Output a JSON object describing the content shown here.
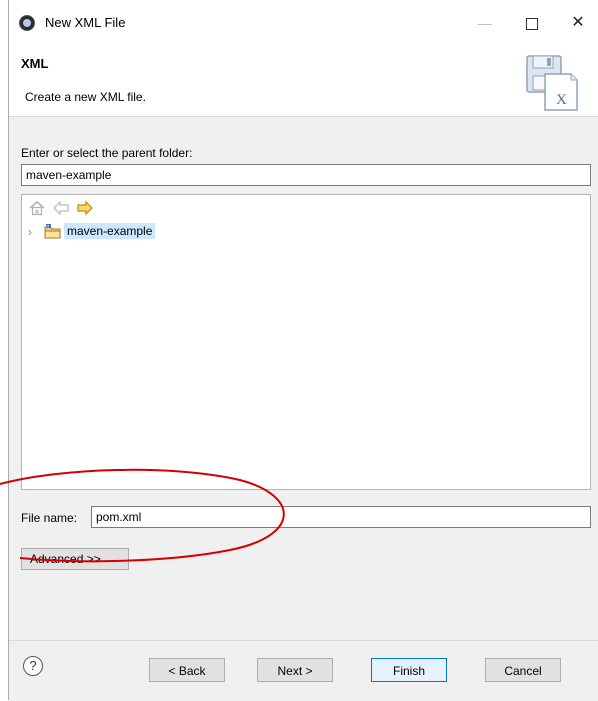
{
  "window": {
    "title": "New XML File"
  },
  "banner": {
    "title": "XML",
    "description": "Create a new XML file."
  },
  "folder": {
    "label": "Enter or select the parent folder:",
    "value": "maven-example",
    "tree": [
      {
        "label": "maven-example",
        "icon": "project-folder-icon",
        "selected": true
      }
    ]
  },
  "file": {
    "label": "File name:",
    "value": "pom.xml"
  },
  "advanced_label": "Advanced >>",
  "buttons": {
    "back": "< Back",
    "next": "Next >",
    "finish": "Finish",
    "cancel": "Cancel",
    "help": "?"
  },
  "colors": {
    "annotation": "#d40000",
    "selection": "#cce8ff",
    "focus": "#0078d7"
  }
}
